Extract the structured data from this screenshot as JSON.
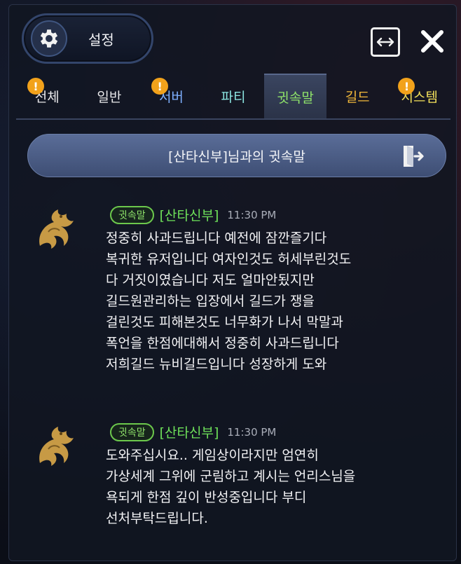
{
  "header": {
    "settings_label": "설정"
  },
  "tabs": [
    {
      "label": "전체",
      "alert": true,
      "color": "#e8e8ea",
      "active": false
    },
    {
      "label": "일반",
      "alert": false,
      "color": "#e8e8ea",
      "active": false
    },
    {
      "label": "서버",
      "alert": true,
      "color": "#7fb0ff",
      "active": false
    },
    {
      "label": "파티",
      "alert": false,
      "color": "#8be4e0",
      "active": false
    },
    {
      "label": "귓속말",
      "alert": false,
      "color": "#8fe36a",
      "active": true
    },
    {
      "label": "길드",
      "alert": false,
      "color": "#f2b83a",
      "active": false
    },
    {
      "label": "시스템",
      "alert": true,
      "color": "#f2e05a",
      "active": false
    }
  ],
  "alert_glyph": "!",
  "whisper": {
    "title": "[산타신부]님과의 귓속말"
  },
  "messages": [
    {
      "badge": "귓속말",
      "sender": "[산타신부]",
      "time": "11:30 PM",
      "lines": [
        "정중히 사과드립니다 예전에 잠깐즐기다",
        "복귀한 유저입니다  여자인것도 허세부린것도",
        "다 거짓이였습니다 저도 얼마안됬지만",
        "길드원관리하는 입장에서 길드가 쟁을",
        "걸린것도 피해본것도 너무화가 나서 막말과",
        "폭언을 한점에대해서 정중히 사과드립니다",
        "저희길드 뉴비길드입니다 성장하게 도와"
      ]
    },
    {
      "badge": "귓속말",
      "sender": "[산타신부]",
      "time": "11:30 PM",
      "lines": [
        "도와주십시요.. 게임상이라지만 엄연히",
        "가상세계 그위에 군림하고 계시는 언리스님을",
        "욕되게 한점 깊이 반성중입니다 부디",
        "선처부탁드립니다."
      ]
    }
  ],
  "icons": {
    "gear": "gear-icon",
    "resize": "resize-icon",
    "close": "close-icon",
    "exit": "exit-chat-icon",
    "avatar": "dragon-emblem-icon"
  },
  "colors": {
    "accent_green": "#6ee05a",
    "alert_orange": "#f2a21b",
    "bar_blue": "#4e5f88"
  }
}
